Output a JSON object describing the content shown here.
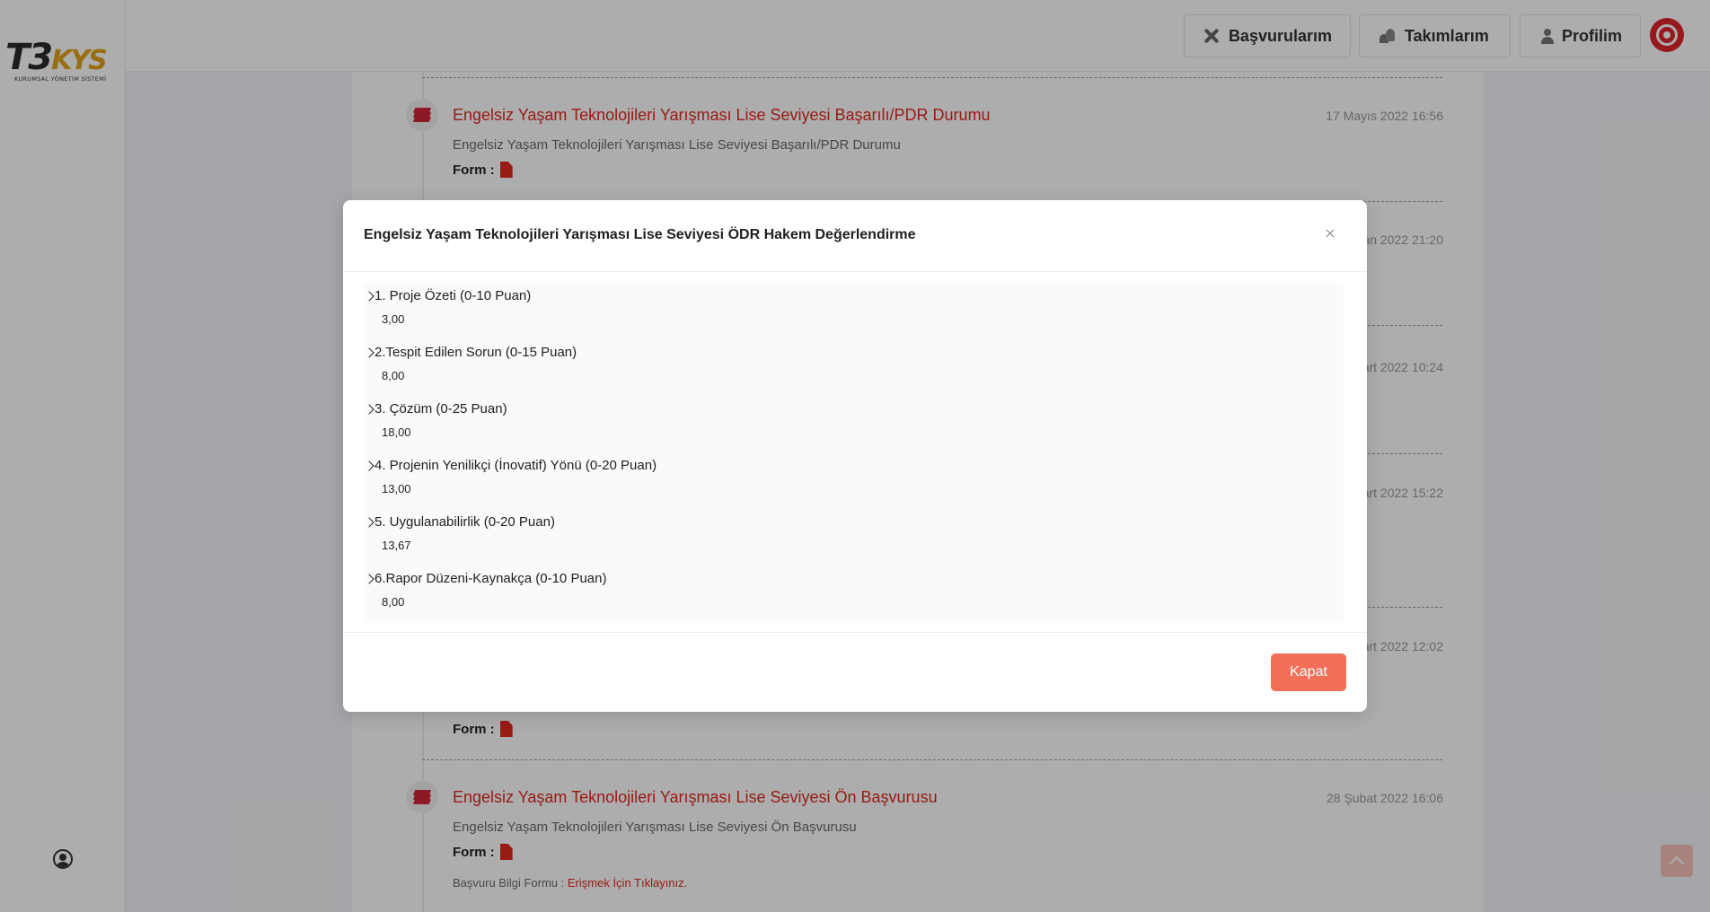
{
  "logo": {
    "main": "T3",
    "accent": "KYS",
    "sub": "KURUMSAL YÖNETİM SİSTEMİ"
  },
  "header": {
    "buttons": [
      {
        "label": "Başvurularım",
        "icon": "tools-icon"
      },
      {
        "label": "Takımlarım",
        "icon": "team-icon"
      },
      {
        "label": "Profilim",
        "icon": "user-icon"
      }
    ],
    "avatar_icon": "radiation-avatar-icon"
  },
  "timeline": {
    "items": [
      {
        "title": "Engelsiz Yaşam Teknolojileri Yarışması Lise Seviyesi Başarılı/PDR Durumu",
        "desc": "Engelsiz Yaşam Teknolojileri Yarışması Lise Seviyesi Başarılı/PDR Durumu",
        "date": "17 Mayıs 2022 16:56",
        "form_label": "Form :"
      },
      {
        "date": "an 2022 21:20"
      },
      {
        "date": "art 2022 10:24"
      },
      {
        "date": "art 2022 15:22"
      },
      {
        "date": "art 2022 12:02",
        "form_label": "Form :"
      },
      {
        "title": "Engelsiz Yaşam Teknolojileri Yarışması Lise Seviyesi Ön Başvurusu",
        "desc": "Engelsiz Yaşam Teknolojileri Yarışması Lise Seviyesi Ön Başvurusu",
        "date": "28 Şubat 2022 16:06",
        "form_label": "Form :",
        "info_label": "Başvuru Bilgi Formu :",
        "info_link": "Erişmek İçin Tıklayınız."
      }
    ]
  },
  "modal": {
    "title": "Engelsiz Yaşam Teknolojileri Yarışması Lise Seviyesi ÖDR Hakem Değerlendirme",
    "close": "×",
    "criteria": [
      {
        "label": "1. Proje Özeti (0-10 Puan)",
        "score": "3,00"
      },
      {
        "label": "2.Tespit Edilen Sorun  (0-15 Puan)",
        "score": "8,00"
      },
      {
        "label": "3. Çözüm  (0-25 Puan)",
        "score": "18,00"
      },
      {
        "label": "4. Projenin Yenilikçi (İnovatif) Yönü (0-20 Puan)",
        "score": "13,00"
      },
      {
        "label": "5. Uygulanabilirlik (0-20 Puan)",
        "score": "13,67"
      },
      {
        "label": "6.Rapor Düzeni-Kaynakça (0-10 Puan)",
        "score": "8,00"
      }
    ],
    "close_button": "Kapat"
  },
  "colors": {
    "accent": "#e0291f",
    "button": "#f2705a",
    "overlay": "rgba(0,0,0,0.32)"
  }
}
